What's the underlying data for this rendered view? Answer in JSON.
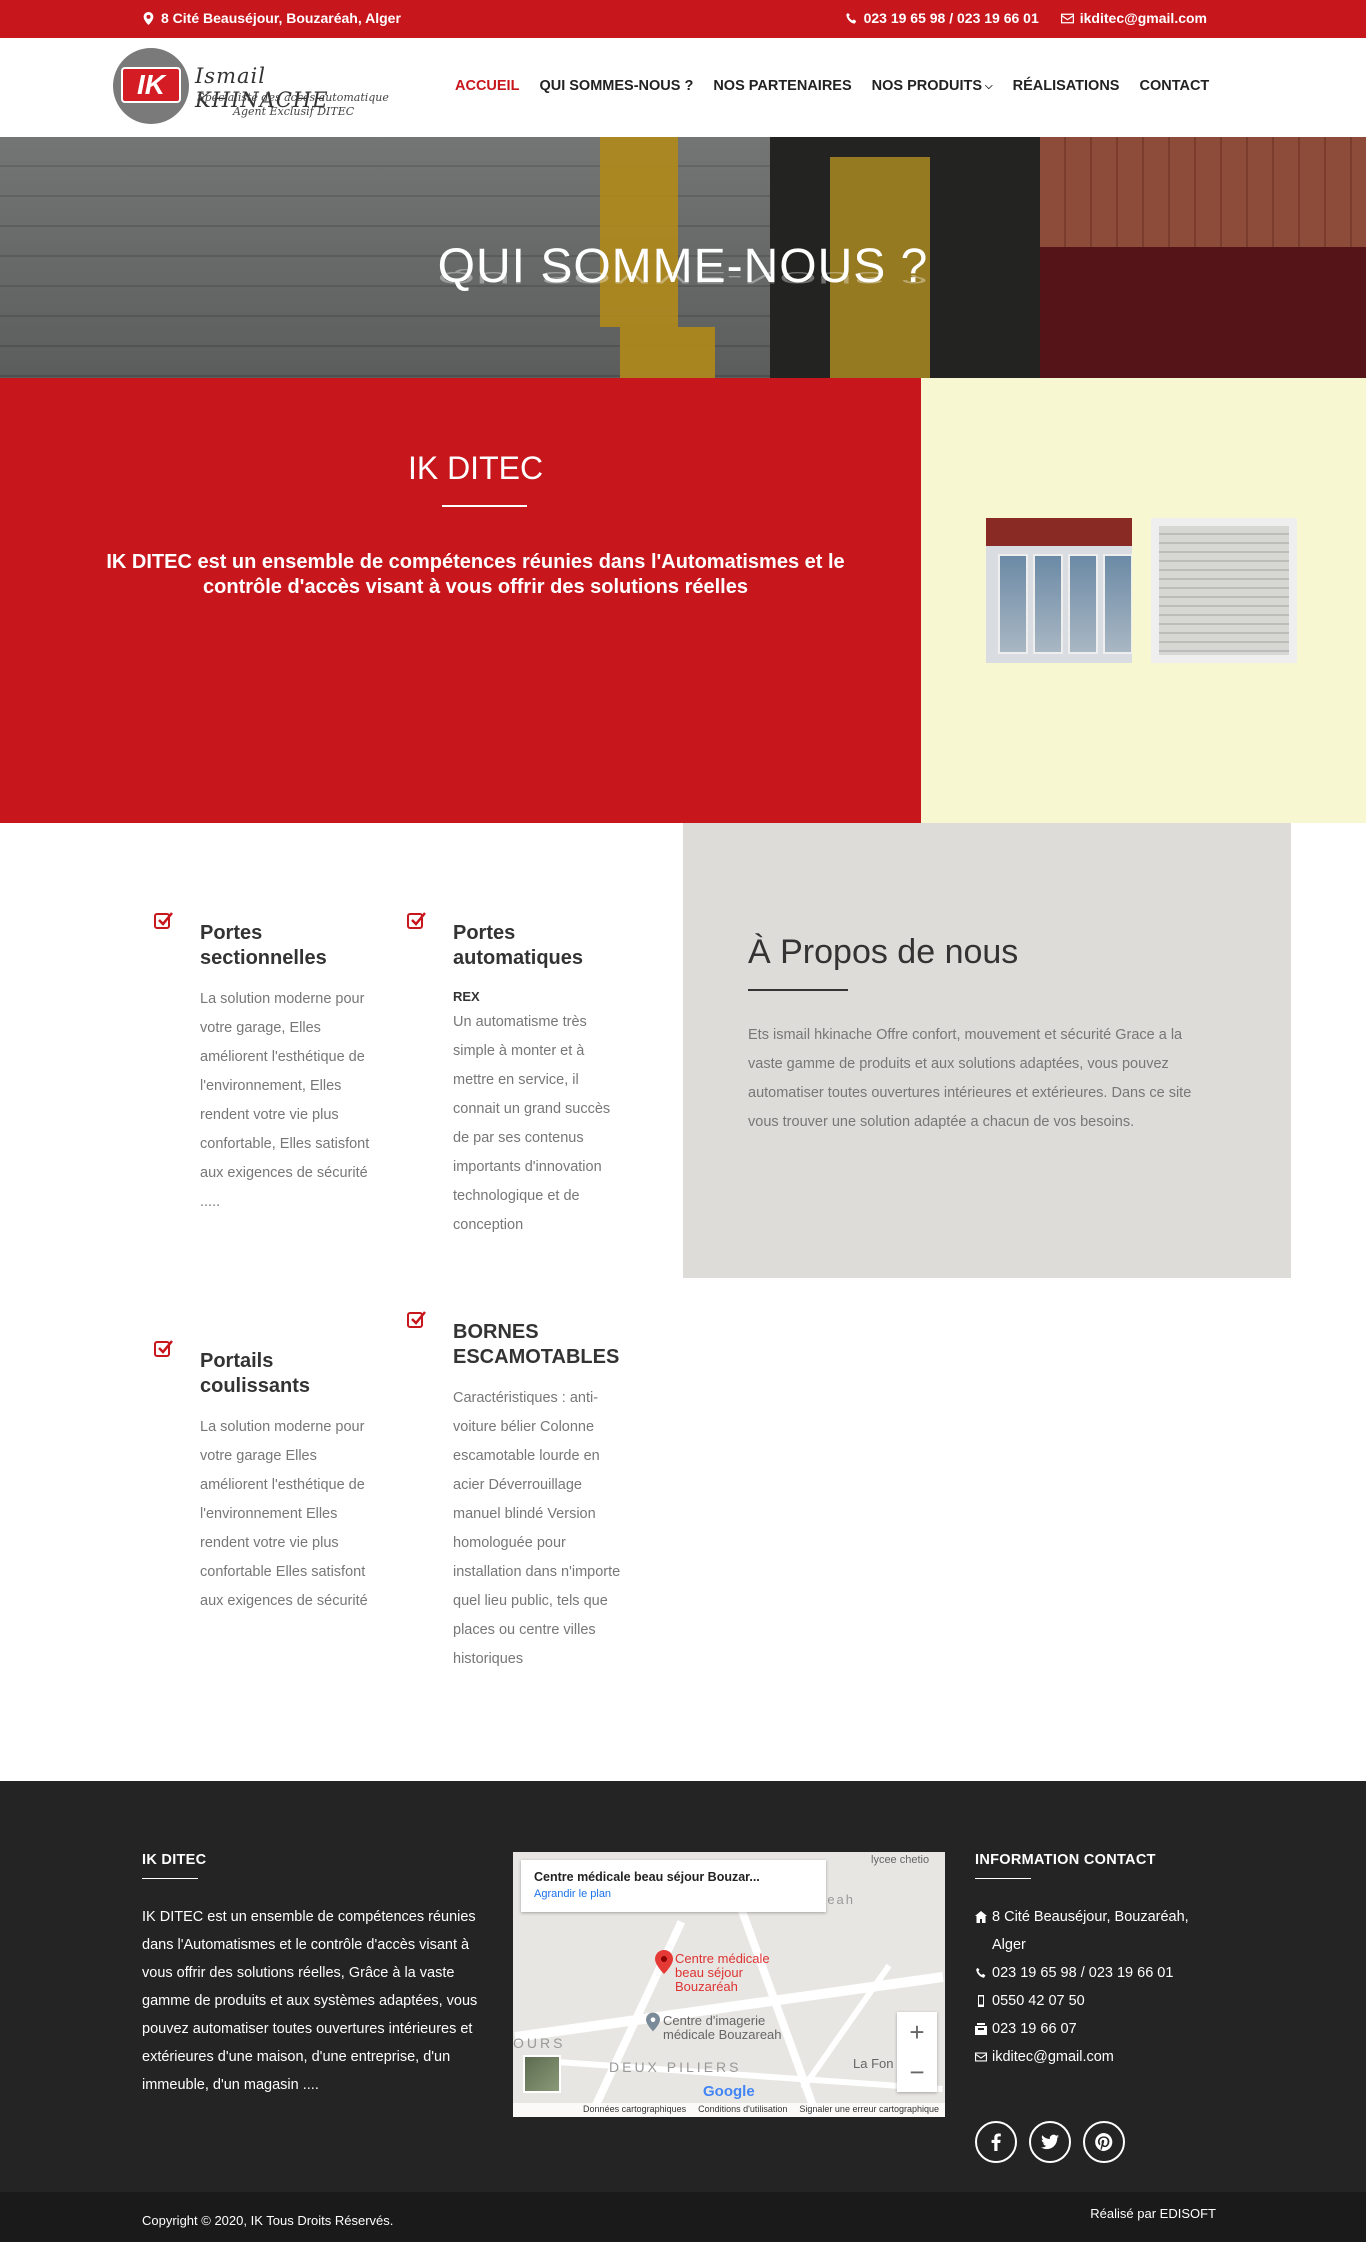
{
  "topbar": {
    "address": "8 Cité Beauséjour, Bouzaréah, Alger",
    "phone": "023 19 65 98 / 023 19 66 01",
    "email": "ikditec@gmail.com",
    "accent_color": "#c8161d"
  },
  "logo": {
    "mark": "IK",
    "name": "Ismail KHINACHE",
    "subtitle": "Specialiste des accès automatique",
    "tagline": "Agent Exclusif DITEC"
  },
  "nav": {
    "items": [
      {
        "label": "ACCUEIL",
        "active": true
      },
      {
        "label": "QUI SOMMES-NOUS ?"
      },
      {
        "label": "NOS PARTENAIRES"
      },
      {
        "label": "NOS PRODUITS",
        "dropdown": true
      },
      {
        "label": "RÉALISATIONS"
      },
      {
        "label": "CONTACT"
      }
    ]
  },
  "hero": {
    "title": "QUI SOMME-NOUS ?"
  },
  "intro": {
    "title": "IK DITEC",
    "text": "IK DITEC est un ensemble de compétences réunies dans l'Automatismes et le contrôle d'accès visant à vous offrir des solutions réelles"
  },
  "features": [
    {
      "title": "Portes sectionnelles",
      "subtitle": "",
      "text": "La solution moderne pour votre garage, Elles améliorent l'esthétique de l'environnement, Elles rendent votre vie plus confortable, Elles satisfont aux exigences de sécurité ....."
    },
    {
      "title": "Portes automatiques",
      "subtitle": "REX",
      "text": "Un automatisme très simple à monter et à mettre en service, il connait un grand succès de par ses contenus importants d'innovation technologique et de conception"
    },
    {
      "title": "Portails coulissants",
      "subtitle": "",
      "text": "La solution moderne pour votre garage Elles améliorent l'esthétique de l'environnement Elles rendent votre vie plus confortable Elles satisfont aux exigences de sécurité"
    },
    {
      "title": "BORNES ESCAMOTABLES",
      "subtitle": "",
      "text": "Caractéristiques : anti-voiture bélier Colonne escamotable lourde en acier Déverrouillage manuel blindé Version homologuée pour installation dans n'importe quel lieu public, tels que places ou centre villes historiques"
    }
  ],
  "about": {
    "title": "À Propos de nous",
    "text": "Ets ismail hkinache Offre confort, mouvement et sécurité Grace a la vaste gamme de produits et aux solutions adaptées, vous pouvez automatiser toutes ouvertures intérieures et extérieures. Dans ce site vous trouver une solution adaptée a chacun de vos besoins."
  },
  "footer": {
    "col1_title": "IK DITEC",
    "col1_text": "IK DITEC est un ensemble de compétences réunies dans l'Automatismes et le contrôle d'accès visant à vous offrir des solutions réelles, Grâce à la vaste gamme de produits et aux systèmes adaptées, vous pouvez automatiser toutes ouvertures intérieures et extérieures d'une maison, d'une entreprise, d'un immeuble, d'un magasin ....",
    "map": {
      "place_title": "Centre médicale beau séjour Bouzar...",
      "enlarge_link": "Agrandir le plan",
      "pin_label": "Centre médicale beau séjour Bouzaréah",
      "poi_label": "Centre d'imagerie médicale Bouzareah",
      "area1": "DEUX PILIERS",
      "area2": "OURS",
      "area3": "La Fon",
      "lycee": "lycee chetio",
      "reah": "reah",
      "logo": "Google",
      "footer_links": [
        "Données cartographiques",
        "Conditions d'utilisation",
        "Signaler une erreur cartographique"
      ]
    },
    "col3_title": "INFORMATION CONTACT",
    "contacts": [
      {
        "icon": "home-icon",
        "text": "8 Cité Beauséjour, Bouzaréah, Alger"
      },
      {
        "icon": "phone-icon",
        "text": "023 19 65 98 / 023 19 66 01"
      },
      {
        "icon": "mobile-icon",
        "text": "0550 42 07 50"
      },
      {
        "icon": "fax-icon",
        "text": "023 19 66 07"
      },
      {
        "icon": "envelope-icon",
        "text": "ikditec@gmail.com"
      }
    ],
    "socials": [
      "facebook-icon",
      "twitter-icon",
      "pinterest-icon"
    ]
  },
  "copyright": {
    "left": "Copyright © 2020, IK Tous Droits Réservés.",
    "right": "Réalisé par EDISOFT"
  }
}
